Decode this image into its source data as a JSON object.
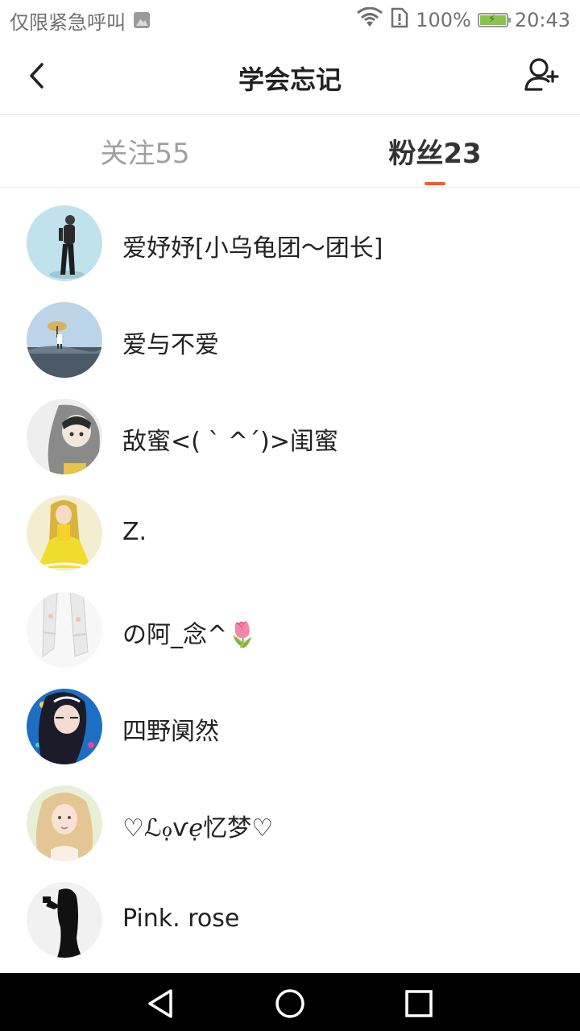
{
  "status_bar": {
    "left_text": "仅限紧急呼叫",
    "battery_text": "100%",
    "battery_level": 1.0,
    "time": "20:43",
    "icons": [
      "image-notification-icon",
      "wifi-icon",
      "sim-alert-icon",
      "battery-charging-icon"
    ]
  },
  "header": {
    "title": "学会忘记",
    "back_icon": "chevron-left-icon",
    "add_user_icon": "add-user-icon"
  },
  "tabs": [
    {
      "label": "关注55",
      "active": false
    },
    {
      "label": "粉丝23",
      "active": true
    }
  ],
  "accent_color": "#ff5a1f",
  "followers": [
    {
      "name": "爱妤妤[小乌龟团～团长]",
      "avatar": "avatar-girl-standing"
    },
    {
      "name": "爱与不爱",
      "avatar": "avatar-umbrella-landscape"
    },
    {
      "name": "敌蜜<( ` ^´)>闺蜜",
      "avatar": "avatar-girl-hood"
    },
    {
      "name": "Z.",
      "avatar": "avatar-yellow-dress"
    },
    {
      "name": "の阿_念^🌷",
      "avatar": "avatar-legs-stockings"
    },
    {
      "name": "四野阒然",
      "avatar": "avatar-anime-blue"
    },
    {
      "name": "♡ℒℴ̣ѵℯ̣忆梦♡",
      "avatar": "avatar-blonde-girl"
    },
    {
      "name": "Pink. rose",
      "avatar": "avatar-silhouette-girl"
    }
  ],
  "nav_bar": {
    "icons": [
      "back-triangle-icon",
      "home-circle-icon",
      "recents-square-icon"
    ]
  }
}
